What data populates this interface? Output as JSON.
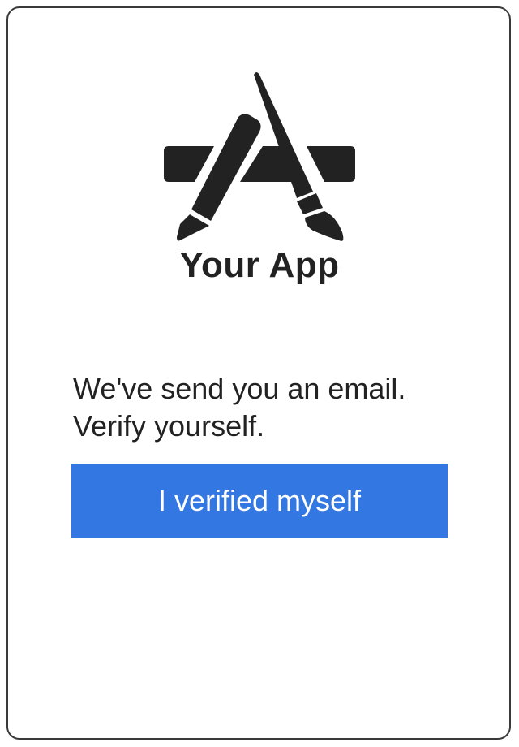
{
  "app": {
    "logo_icon": "app-store-a-icon",
    "title": "Your App"
  },
  "verification": {
    "message_line1": "We've send you an email.",
    "message_line2": "Verify yourself.",
    "button_label": "I verified myself"
  },
  "colors": {
    "accent": "#3277e2",
    "text": "#222222",
    "icon": "#222222",
    "frame_border": "#3a3a3a"
  }
}
